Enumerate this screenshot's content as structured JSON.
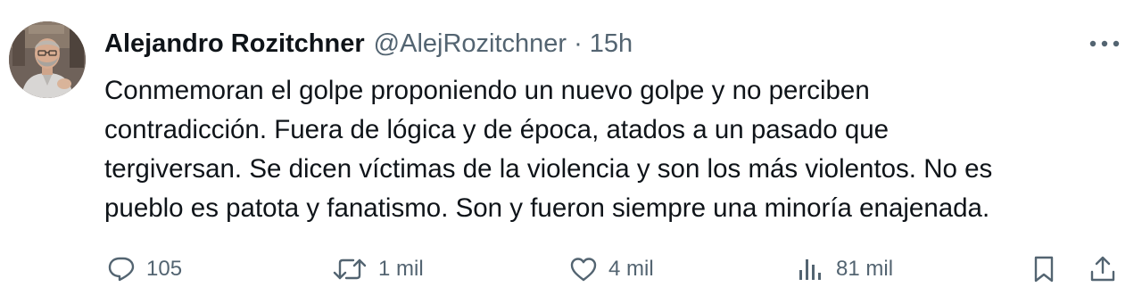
{
  "tweet": {
    "display_name": "Alejandro Rozitchner",
    "handle": "@AlejRozitchner",
    "separator": "·",
    "time": "15h",
    "text_lines": [
      "Conmemoran el golpe proponiendo un nuevo golpe y no perciben",
      "contradicción. Fuera de lógica y de época, atados a un pasado que",
      "tergiversan. Se dicen víctimas de la violencia y son los más violentos. No es",
      "pueblo es patota y fanatismo. Son y fueron siempre una minoría enajenada."
    ]
  },
  "actions": {
    "replies": "105",
    "retweets": "1 mil",
    "likes": "4 mil",
    "views": "81 mil"
  },
  "icons": {
    "more": "more-dots-icon",
    "reply": "comment-icon",
    "retweet": "retweet-icon",
    "like": "heart-icon",
    "views": "analytics-icon",
    "bookmark": "bookmark-icon",
    "share": "share-icon"
  },
  "colors": {
    "text": "#0f1419",
    "secondary": "#536471",
    "background": "#ffffff"
  }
}
